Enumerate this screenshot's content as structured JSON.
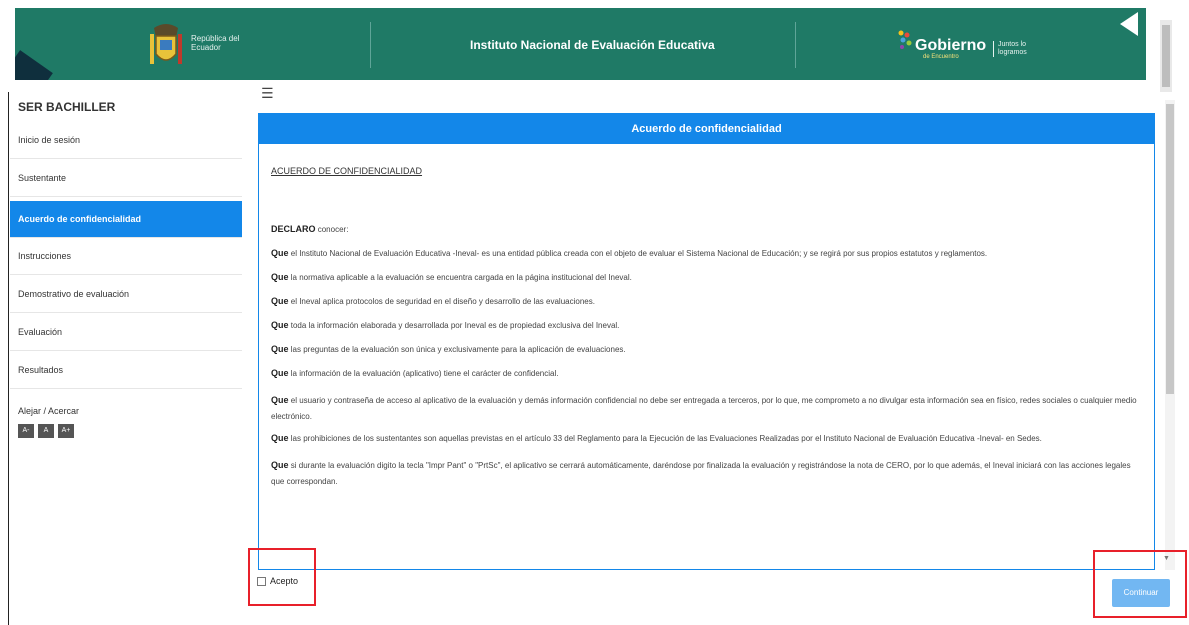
{
  "header": {
    "republic": "República del Ecuador",
    "institute": "Instituto Nacional de Evaluación Educativa",
    "gobierno": "Gobierno",
    "gobierno_sub": "de Encuentro",
    "gobierno_right": "Juntos lo logramos"
  },
  "sidebar": {
    "title": "SER BACHILLER",
    "items": [
      {
        "label": "Inicio de sesión"
      },
      {
        "label": "Sustentante"
      },
      {
        "label": "Acuerdo de confidencialidad"
      },
      {
        "label": "Instrucciones"
      },
      {
        "label": "Demostrativo de evaluación"
      },
      {
        "label": "Evaluación"
      },
      {
        "label": "Resultados"
      }
    ],
    "zoom_label": "Alejar / Acercar",
    "zoom_buttons": [
      "A-",
      "A",
      "A+"
    ]
  },
  "panel": {
    "title": "Acuerdo de confidencialidad",
    "doc_title": "ACUERDO DE CONFIDENCIALIDAD",
    "declaro": "DECLARO",
    "declaro_rest": "conocer:",
    "que": "Que",
    "clauses": [
      "el Instituto Nacional de Evaluación Educativa -Ineval- es una entidad pública creada con el objeto de evaluar el Sistema Nacional de Educación; y se regirá por sus propios estatutos y reglamentos.",
      "la normativa aplicable a la evaluación se encuentra cargada en la página institucional del Ineval.",
      "el Ineval aplica protocolos de seguridad en el diseño y desarrollo de las evaluaciones.",
      "toda la información elaborada y desarrollada por Ineval es de propiedad exclusiva del Ineval.",
      "las preguntas de la evaluación son única y exclusivamente para la aplicación de evaluaciones.",
      "la información de la evaluación (aplicativo) tiene el carácter de confidencial.",
      "el usuario y contraseña de acceso al aplicativo de la evaluación y demás información confidencial no debe ser entregada a terceros, por lo que, me comprometo a no divulgar esta información sea en físico, redes sociales o cualquier medio electrónico.",
      "las prohibiciones de los sustentantes son aquellas previstas en el artículo 33 del Reglamento para la Ejecución de las Evaluaciones Realizadas por el Instituto Nacional de Evaluación Educativa -Ineval- en Sedes.",
      "si durante la evaluación digito la tecla \"Impr Pant\" o \"PrtSc\", el aplicativo se cerrará automáticamente, daréndose por finalizada la evaluación y registrándose la nota de CERO, por lo que además, el Ineval iniciará con las acciones legales que correspondan."
    ]
  },
  "accept": {
    "label": "Acepto",
    "checked": false
  },
  "continue_button": {
    "label": "Continuar"
  }
}
